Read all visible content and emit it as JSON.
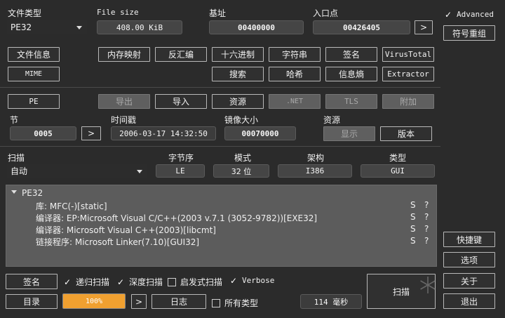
{
  "top": {
    "file_type_label": "文件类型",
    "file_type_value": "PE32",
    "file_size_label": "File size",
    "file_size_value": "408.00 KiB",
    "base_label": "基址",
    "base_value": "00400000",
    "entry_label": "入口点",
    "entry_value": "00426405",
    "entry_go": ">"
  },
  "right": {
    "advanced_label": "Advanced",
    "advanced_checked": "✓",
    "symbol_reorg": "符号重组",
    "shortcuts": "快捷键",
    "options": "选项",
    "about": "关于",
    "exit": "退出"
  },
  "tools_row1": {
    "file_info": "文件信息",
    "memory_map": "内存映射",
    "disassembly": "反汇编",
    "hex": "十六进制",
    "strings": "字符串",
    "signature": "签名",
    "virustotal": "VirusTotal"
  },
  "tools_row2": {
    "mime": "MIME",
    "search": "搜索",
    "hash": "哈希",
    "entropy": "信息熵",
    "extractor": "Extractor"
  },
  "pe_row": {
    "pe": "PE",
    "export": "导出",
    "import": "导入",
    "resources": "资源",
    "net": ".NET",
    "tls": "TLS",
    "overlay": "附加"
  },
  "sections": {
    "section_label": "节",
    "section_value": "0005",
    "section_go": ">",
    "timestamp_label": "时间戳",
    "timestamp_value": "2006-03-17 14:32:50",
    "image_size_label": "镜像大小",
    "image_size_value": "00070000",
    "resources_label": "资源",
    "show_button": "显示",
    "version_button": "版本"
  },
  "scan_info": {
    "scan_label": "扫描",
    "scan_value": "自动",
    "endian_label": "字节序",
    "endian_value": "LE",
    "mode_label": "模式",
    "mode_value": "32 位",
    "arch_label": "架构",
    "arch_value": "I386",
    "type_label": "类型",
    "type_value": "GUI"
  },
  "results": {
    "root": "PE32",
    "rows": [
      {
        "text": "库: MFC(-)[static]",
        "s": "S",
        "q": "?"
      },
      {
        "text": "编译器: EP:Microsoft Visual C/C++(2003 v.7.1 (3052-9782))[EXE32]",
        "s": "S",
        "q": "?"
      },
      {
        "text": "编译器: Microsoft Visual C++(2003)[libcmt]",
        "s": "S",
        "q": "?"
      },
      {
        "text": "链接程序: Microsoft Linker(7.10)[GUI32]",
        "s": "S",
        "q": "?"
      }
    ]
  },
  "bottom": {
    "signatures": "签名",
    "recursive_scan": "递归扫描",
    "deep_scan": "深度扫描",
    "heuristic_scan": "启发式扫描",
    "verbose": "Verbose",
    "directory": "目录",
    "progress": "100%",
    "progress_fraction": 1.0,
    "progress_go": ">",
    "log": "日志",
    "all_types": "所有类型",
    "elapsed": "114 毫秒",
    "scan_button": "扫描",
    "check": "✓"
  },
  "colors": {
    "background": "#2b2b2b",
    "progress": "#f0a030",
    "panel": "#5c5c5c"
  }
}
